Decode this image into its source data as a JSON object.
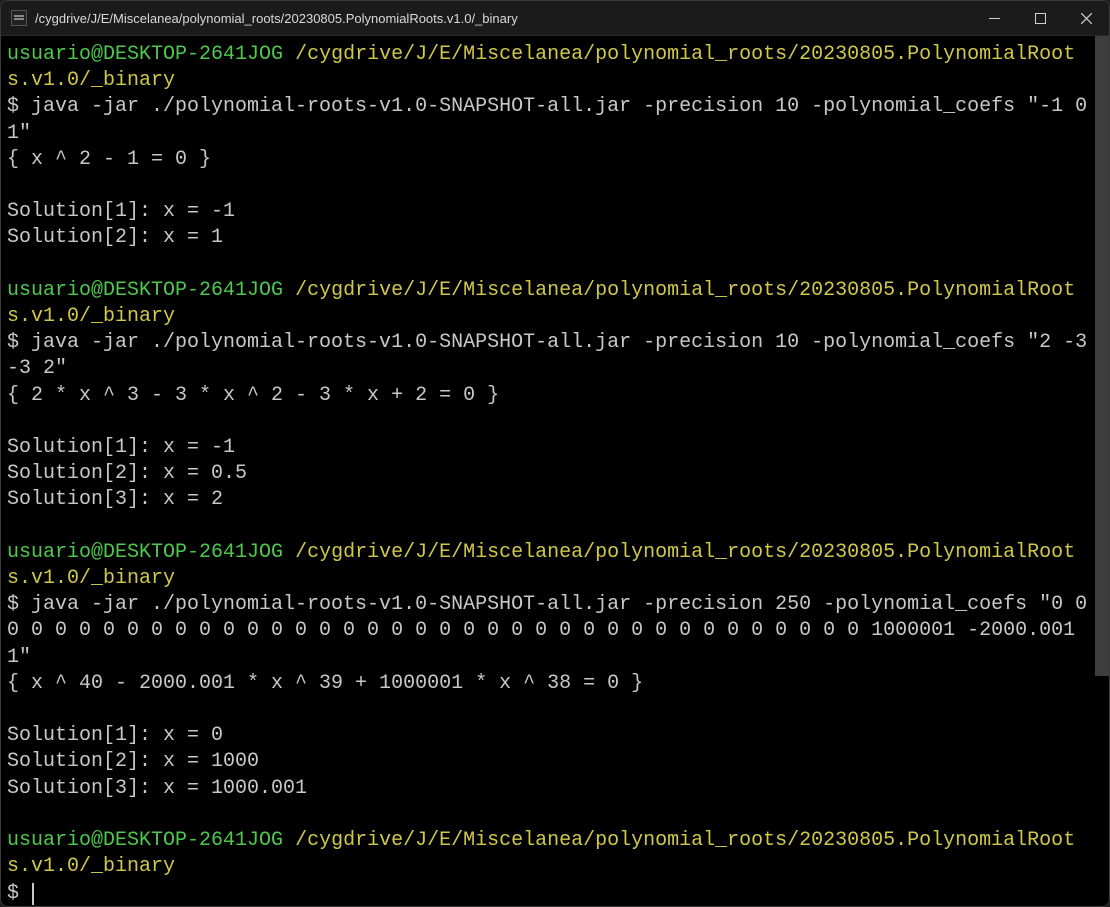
{
  "window": {
    "title": "/cygdrive/J/E/Miscelanea/polynomial_roots/20230805.PolynomialRoots.v1.0/_binary"
  },
  "prompt": {
    "user_host": "usuario@DESKTOP-2641JOG",
    "path": "/cygdrive/J/E/Miscelanea/polynomial_roots/20230805.PolynomialRoots.v1.0/_binary",
    "symbol": "$"
  },
  "blocks": [
    {
      "command": "java -jar ./polynomial-roots-v1.0-SNAPSHOT-all.jar -precision 10 -polynomial_coefs \"-1 0 1\"",
      "equation": "{ x ^ 2 - 1 = 0 }",
      "solutions": [
        "Solution[1]: x = -1",
        "Solution[2]: x = 1"
      ]
    },
    {
      "command": "java -jar ./polynomial-roots-v1.0-SNAPSHOT-all.jar -precision 10 -polynomial_coefs \"2 -3 -3 2\"",
      "equation": "{ 2 * x ^ 3 - 3 * x ^ 2 - 3 * x + 2 = 0 }",
      "solutions": [
        "Solution[1]: x = -1",
        "Solution[2]: x = 0.5",
        "Solution[3]: x = 2"
      ]
    },
    {
      "command": "java -jar ./polynomial-roots-v1.0-SNAPSHOT-all.jar -precision 250 -polynomial_coefs \"0 0 0 0 0 0 0 0 0 0 0 0 0 0 0 0 0 0 0 0 0 0 0 0 0 0 0 0 0 0 0 0 0 0 0 0 0 0 1000001 -2000.001 1\"",
      "equation": "{ x ^ 40 - 2000.001 * x ^ 39 + 1000001 * x ^ 38 = 0 }",
      "solutions": [
        "Solution[1]: x = 0",
        "Solution[2]: x = 1000",
        "Solution[3]: x = 1000.001"
      ]
    }
  ]
}
